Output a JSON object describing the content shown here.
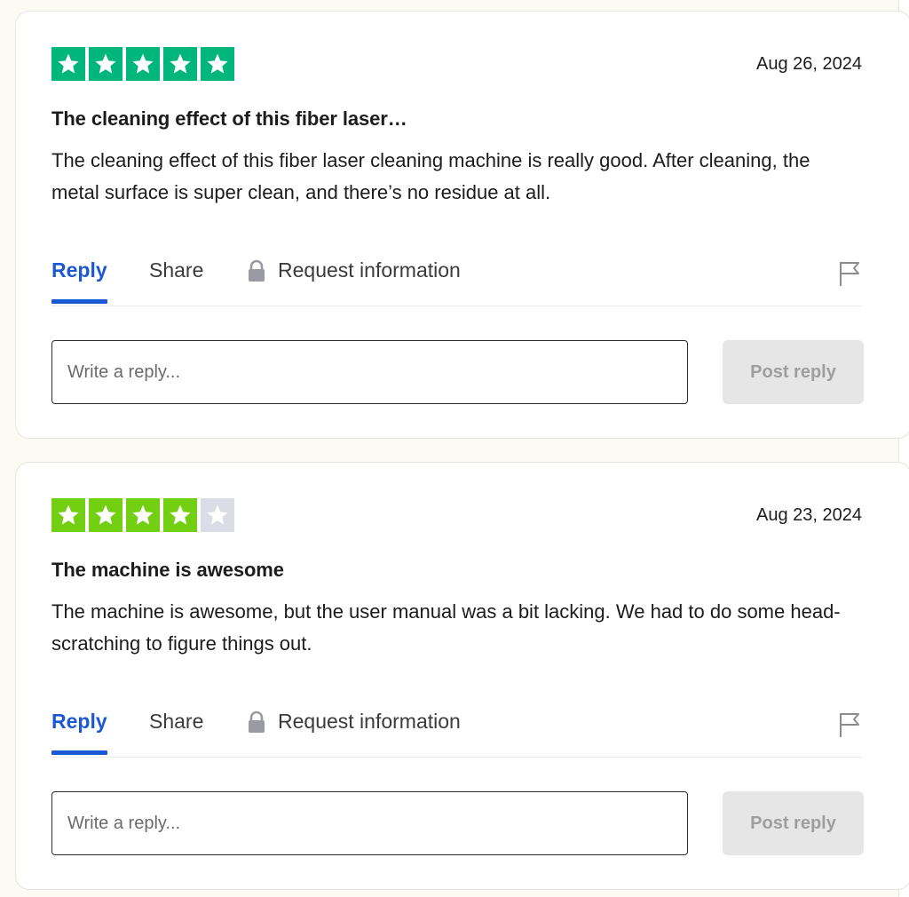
{
  "reviews": [
    {
      "rating": 5,
      "rating_max": 5,
      "star_color": "#00b67a",
      "empty_star_color": "#dcdce6",
      "date": "Aug 26, 2024",
      "title": "The cleaning effect of this fiber laser…",
      "body": "The cleaning effect of this fiber laser cleaning machine is really good. After cleaning, the metal surface is super clean, and there’s no residue at all.",
      "actions": {
        "reply": "Reply",
        "share": "Share",
        "request": "Request information"
      },
      "reply_placeholder": "Write a reply...",
      "post_label": "Post reply"
    },
    {
      "rating": 4,
      "rating_max": 5,
      "star_color": "#73cf11",
      "empty_star_color": "#dcdce6",
      "date": "Aug 23, 2024",
      "title": "The machine is awesome",
      "body": "The machine is awesome, but the user manual was a bit lacking. We had to do some head-scratching to figure things out.",
      "actions": {
        "reply": "Reply",
        "share": "Share",
        "request": "Request information"
      },
      "reply_placeholder": "Write a reply...",
      "post_label": "Post reply"
    }
  ],
  "icons": {
    "star": "star-icon",
    "lock": "lock-icon",
    "flag": "flag-icon"
  },
  "colors": {
    "accent": "#1a58d4",
    "background": "#fbfaf3"
  }
}
